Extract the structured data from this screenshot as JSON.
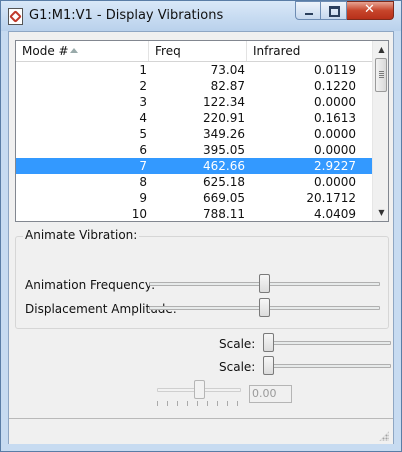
{
  "window": {
    "title": "G1:M1:V1 - Display Vibrations",
    "icons": {
      "app": "document-icon",
      "minimize": "minimize-icon",
      "maximize": "maximize-icon",
      "close": "close-icon"
    }
  },
  "table": {
    "columns": [
      "Mode #",
      "Freq",
      "Infrared"
    ],
    "rows": [
      {
        "mode": "1",
        "freq": "73.04",
        "ir": "0.0119"
      },
      {
        "mode": "2",
        "freq": "82.87",
        "ir": "0.1220"
      },
      {
        "mode": "3",
        "freq": "122.34",
        "ir": "0.0000"
      },
      {
        "mode": "4",
        "freq": "220.91",
        "ir": "0.1613"
      },
      {
        "mode": "5",
        "freq": "349.26",
        "ir": "0.0000"
      },
      {
        "mode": "6",
        "freq": "395.05",
        "ir": "0.0000"
      },
      {
        "mode": "7",
        "freq": "462.66",
        "ir": "2.9227"
      },
      {
        "mode": "8",
        "freq": "625.18",
        "ir": "0.0000"
      },
      {
        "mode": "9",
        "freq": "669.05",
        "ir": "20.1712"
      },
      {
        "mode": "10",
        "freq": "788.11",
        "ir": "4.0409"
      }
    ],
    "selected_row": 7,
    "selection_color": "#3399ff"
  },
  "animate": {
    "group_label": "Animate Vibration:",
    "frequency_label": "Animation Frequency:",
    "frequency_level": 0.5,
    "amplitude_label": "Displacement Amplitude:",
    "amplitude_level": 0.5
  },
  "scales": {
    "scale1_label": "Scale:",
    "scale1_level": 0.0,
    "scale2_label": "Scale:",
    "scale2_level": 0.0
  },
  "extra": {
    "disabled_slider_level": 0.5,
    "value_box": "0.00"
  }
}
